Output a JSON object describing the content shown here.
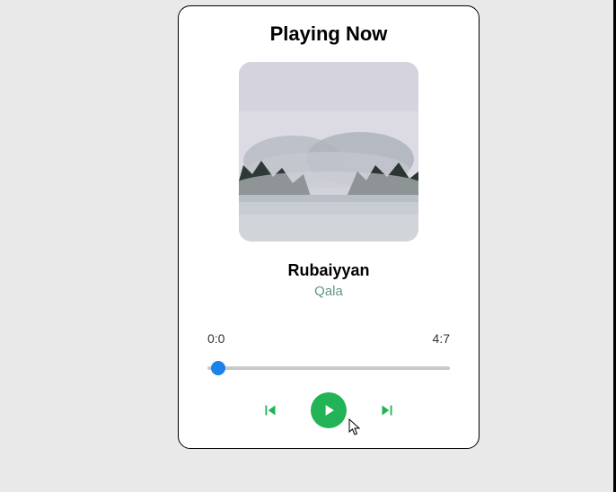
{
  "header": {
    "title": "Playing Now"
  },
  "track": {
    "title": "Rubaiyyan",
    "artist": "Qala"
  },
  "time": {
    "current": "0:0",
    "total": "4:7"
  },
  "controls": {
    "prev": "skip-previous",
    "play": "play",
    "next": "skip-next"
  },
  "colors": {
    "accent": "#22b356",
    "thumb": "#1a82e8"
  }
}
